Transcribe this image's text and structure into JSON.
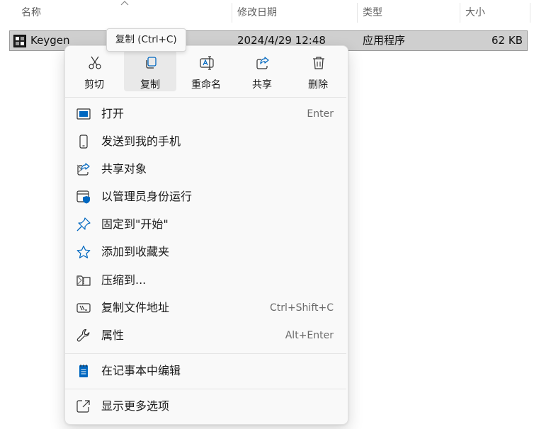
{
  "columns": {
    "name": "名称",
    "modified": "修改日期",
    "type": "类型",
    "size": "大小"
  },
  "file": {
    "name": "Keygen",
    "modified": "2024/4/29 12:48",
    "type": "应用程序",
    "size": "62 KB",
    "icon": "app-window-icon"
  },
  "tooltip": {
    "text": "复制 (Ctrl+C)"
  },
  "quick_actions": [
    {
      "label": "剪切",
      "icon": "scissors-icon"
    },
    {
      "label": "复制",
      "icon": "copy-icon"
    },
    {
      "label": "重命名",
      "icon": "rename-icon"
    },
    {
      "label": "共享",
      "icon": "share-icon"
    },
    {
      "label": "删除",
      "icon": "trash-icon"
    }
  ],
  "menu_items": [
    {
      "label": "打开",
      "shortcut": "Enter",
      "icon": "open-window-icon"
    },
    {
      "label": "发送到我的手机",
      "shortcut": "",
      "icon": "phone-icon"
    },
    {
      "label": "共享对象",
      "shortcut": "",
      "icon": "share-icon"
    },
    {
      "label": "以管理员身份运行",
      "shortcut": "",
      "icon": "admin-shield-icon"
    },
    {
      "label": "固定到\"开始\"",
      "shortcut": "",
      "icon": "pin-icon"
    },
    {
      "label": "添加到收藏夹",
      "shortcut": "",
      "icon": "star-icon"
    },
    {
      "label": "压缩到...",
      "shortcut": "",
      "icon": "zip-folder-icon"
    },
    {
      "label": "复制文件地址",
      "shortcut": "Ctrl+Shift+C",
      "icon": "copy-path-icon"
    },
    {
      "label": "属性",
      "shortcut": "Alt+Enter",
      "icon": "wrench-icon"
    },
    {
      "label": "在记事本中编辑",
      "shortcut": "",
      "icon": "notepad-icon"
    },
    {
      "label": "显示更多选项",
      "shortcut": "",
      "icon": "show-more-icon"
    }
  ],
  "colors": {
    "accent": "#0067c0",
    "selection": "#cfcfcf",
    "menu_bg": "#f9f9f9"
  }
}
